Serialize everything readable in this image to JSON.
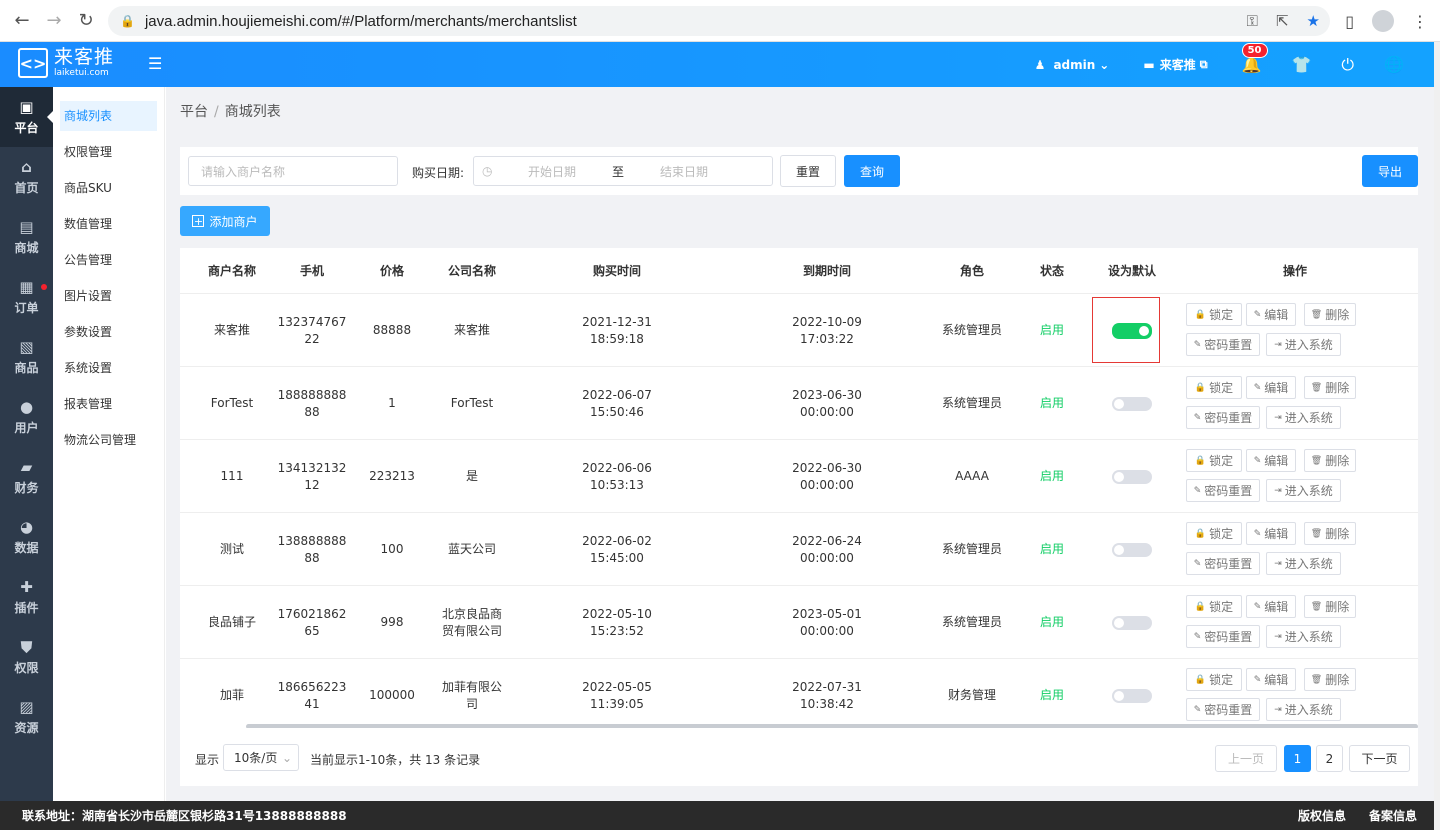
{
  "browser": {
    "url": "java.admin.houjiemeishi.com/#/Platform/merchants/merchantslist"
  },
  "topbar": {
    "logo_cn": "来客推",
    "logo_en": "laiketui.com",
    "user": "admin",
    "store": "来客推",
    "notifications": "50"
  },
  "sidebar": {
    "items": [
      {
        "label": "平台",
        "icon": "platform-icon",
        "active": true
      },
      {
        "label": "首页",
        "icon": "home-icon"
      },
      {
        "label": "商城",
        "icon": "mall-icon"
      },
      {
        "label": "订单",
        "icon": "order-icon",
        "dot": true
      },
      {
        "label": "商品",
        "icon": "goods-icon"
      },
      {
        "label": "用户",
        "icon": "user-icon"
      },
      {
        "label": "财务",
        "icon": "finance-icon"
      },
      {
        "label": "数据",
        "icon": "data-icon"
      },
      {
        "label": "插件",
        "icon": "plugin-icon"
      },
      {
        "label": "权限",
        "icon": "permission-icon"
      },
      {
        "label": "资源",
        "icon": "resource-icon"
      }
    ]
  },
  "submenu": {
    "items": [
      "商城列表",
      "权限管理",
      "商品SKU",
      "数值管理",
      "公告管理",
      "图片设置",
      "参数设置",
      "系统设置",
      "报表管理",
      "物流公司管理"
    ]
  },
  "breadcrumb": {
    "root": "平台",
    "sep": "/",
    "current": "商城列表"
  },
  "filter": {
    "name_placeholder": "请输入商户名称",
    "date_label": "购买日期:",
    "start_placeholder": "开始日期",
    "to": "至",
    "end_placeholder": "结束日期",
    "reset": "重置",
    "query": "查询",
    "export": "导出"
  },
  "add_button": "添加商户",
  "table": {
    "headers": [
      "商户名称",
      "手机",
      "价格",
      "公司名称",
      "购买时间",
      "到期时间",
      "角色",
      "状态",
      "设为默认",
      "操作"
    ],
    "rows": [
      {
        "name": "来客推",
        "phone": [
          "132374767",
          "22"
        ],
        "price": "88888",
        "company": [
          "来客推"
        ],
        "buy": "2021-12-31 18:59:18",
        "expire": "2022-10-09 17:03:22",
        "role": "系统管理员",
        "status": "启用",
        "default": true
      },
      {
        "name": "ForTest",
        "phone": [
          "188888888",
          "88"
        ],
        "price": "1",
        "company": [
          "ForTest"
        ],
        "buy": "2022-06-07 15:50:46",
        "expire": "2023-06-30 00:00:00",
        "role": "系统管理员",
        "status": "启用",
        "default": false
      },
      {
        "name": "111",
        "phone": [
          "134132132",
          "12"
        ],
        "price": "223213",
        "company": [
          "是"
        ],
        "buy": "2022-06-06 10:53:13",
        "expire": "2022-06-30 00:00:00",
        "role": "AAAA",
        "status": "启用",
        "default": false
      },
      {
        "name": "测试",
        "phone": [
          "138888888",
          "88"
        ],
        "price": "100",
        "company": [
          "蓝天公司"
        ],
        "buy": "2022-06-02 15:45:00",
        "expire": "2022-06-24 00:00:00",
        "role": "系统管理员",
        "status": "启用",
        "default": false
      },
      {
        "name": "良品铺子",
        "phone": [
          "176021862",
          "65"
        ],
        "price": "998",
        "company": [
          "北京良品商",
          "贸有限公司"
        ],
        "buy": "2022-05-10 15:23:52",
        "expire": "2023-05-01 00:00:00",
        "role": "系统管理员",
        "status": "启用",
        "default": false
      },
      {
        "name": "加菲",
        "phone": [
          "186656223",
          "41"
        ],
        "price": "100000",
        "company": [
          "加菲有限公",
          "司"
        ],
        "buy": "2022-05-05 11:39:05",
        "expire": "2022-07-31 10:38:42",
        "role": "财务管理",
        "status": "启用",
        "default": false
      }
    ],
    "ops": [
      "锁定",
      "编辑",
      "删除",
      "密码重置",
      "进入系统"
    ]
  },
  "pager": {
    "show": "显示",
    "size": "10条/页",
    "summary": "当前显示1-10条，共 13 条记录",
    "prev": "上一页",
    "pages": [
      "1",
      "2"
    ],
    "next": "下一页"
  },
  "footer": {
    "address": "联系地址：湖南省长沙市岳麓区银杉路31号13888888888",
    "copyright": "版权信息",
    "record": "备案信息"
  }
}
